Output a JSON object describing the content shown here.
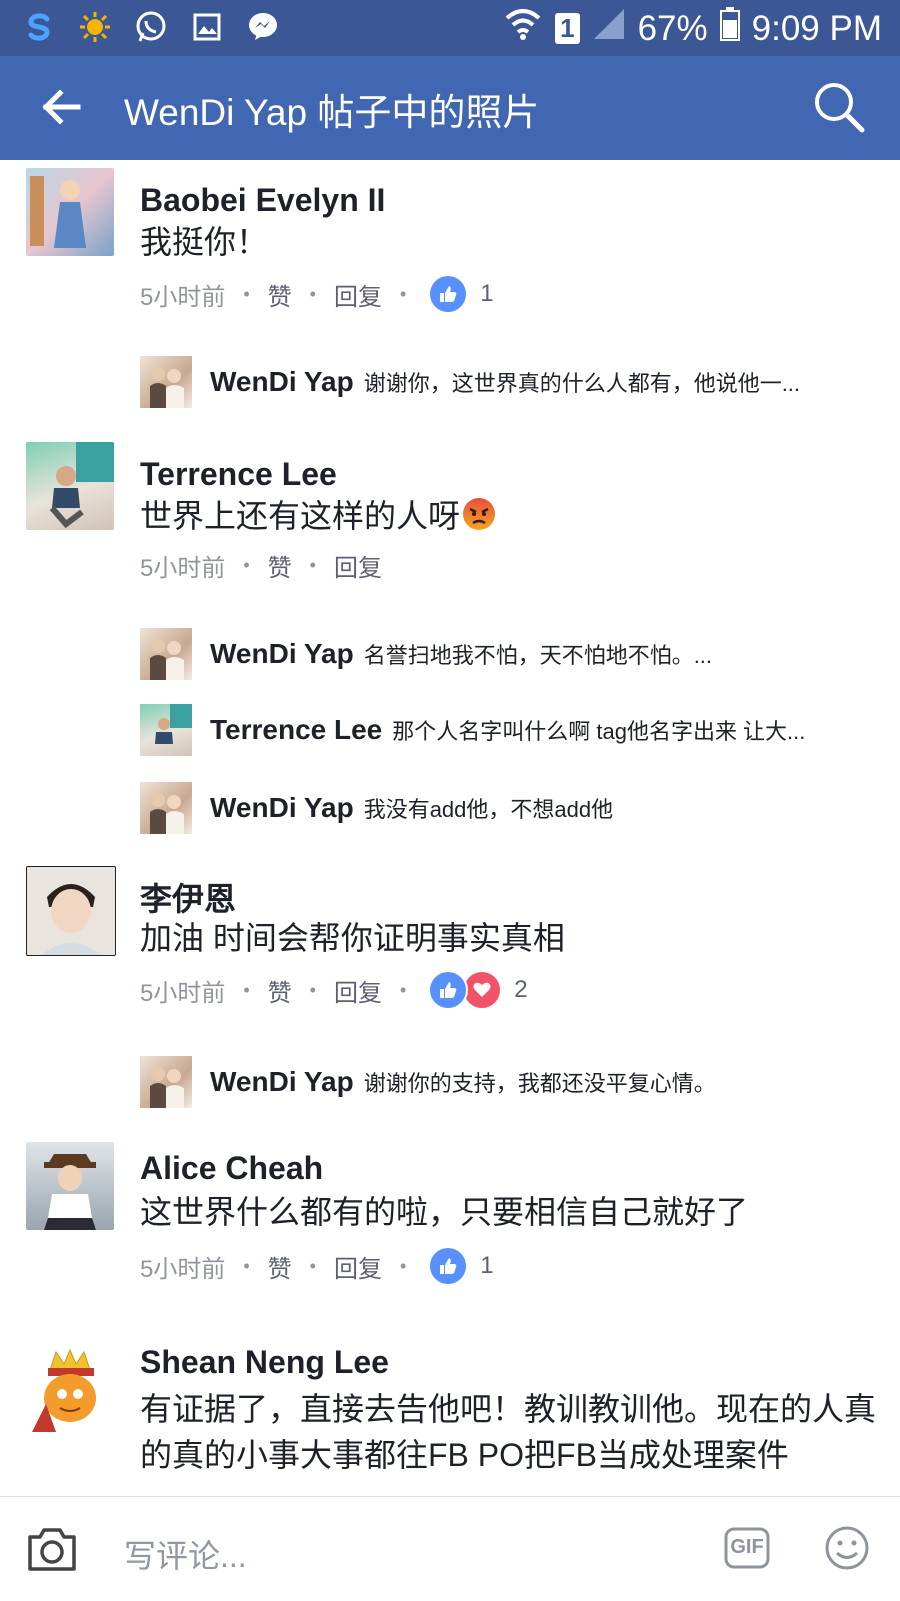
{
  "status_bar": {
    "battery": "67%",
    "time": "9:09 PM",
    "sim": "1"
  },
  "app_bar": {
    "title": "WenDi Yap 帖子中的照片"
  },
  "comments": [
    {
      "name": "Baobei Evelyn II",
      "text": "我挺你！",
      "time": "5小时前",
      "like": "赞",
      "reply": "回复",
      "reaction_count": "1",
      "replies": [
        {
          "name": "WenDi Yap",
          "text": "谢谢你，这世界真的什么人都有，他说他一..."
        }
      ]
    },
    {
      "name": "Terrence Lee",
      "text": "世界上还有这样的人呀",
      "time": "5小时前",
      "like": "赞",
      "reply": "回复",
      "replies": [
        {
          "name": "WenDi Yap",
          "text": "名誉扫地我不怕，天不怕地不怕。..."
        },
        {
          "name": "Terrence Lee",
          "text": "那个人名字叫什么啊 tag他名字出来 让大..."
        },
        {
          "name": "WenDi Yap",
          "text": "我没有add他，不想add他"
        }
      ]
    },
    {
      "name": "李伊恩",
      "text": "加油 时间会帮你证明事实真相",
      "time": "5小时前",
      "like": "赞",
      "reply": "回复",
      "reaction_count": "2",
      "replies": [
        {
          "name": "WenDi Yap",
          "text": "谢谢你的支持，我都还没平复心情。"
        }
      ]
    },
    {
      "name": "Alice Cheah",
      "text": "这世界什么都有的啦，只要相信自己就好了",
      "time": "5小时前",
      "like": "赞",
      "reply": "回复",
      "reaction_count": "1"
    },
    {
      "name": "Shean Neng  Lee",
      "text": "有证据了，直接去告他吧！教训教训他。现在的人真的真的小事大事都往FB PO把FB当成处理案件"
    }
  ],
  "composer": {
    "placeholder": "写评论...",
    "gif_label": "GIF"
  },
  "colors": {
    "header": "#4267b2",
    "status_bar": "#3b5796",
    "like_blue": "#5890ff",
    "love_red": "#f25268"
  }
}
